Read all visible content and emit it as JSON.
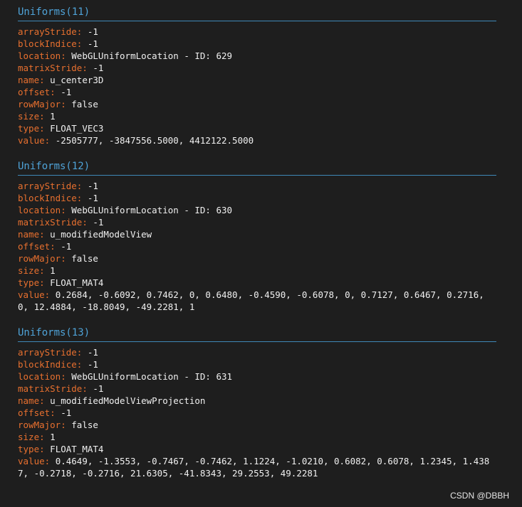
{
  "sections": [
    {
      "title": "Uniforms(11)",
      "rows": [
        {
          "key": "arrayStride",
          "value": "-1"
        },
        {
          "key": "blockIndice",
          "value": "-1"
        },
        {
          "key": "location",
          "value": "WebGLUniformLocation - ID: 629"
        },
        {
          "key": "matrixStride",
          "value": "-1"
        },
        {
          "key": "name",
          "value": "u_center3D"
        },
        {
          "key": "offset",
          "value": "-1"
        },
        {
          "key": "rowMajor",
          "value": "false"
        },
        {
          "key": "size",
          "value": "1"
        },
        {
          "key": "type",
          "value": "FLOAT_VEC3"
        },
        {
          "key": "value",
          "value": "-2505777, -3847556.5000, 4412122.5000"
        }
      ]
    },
    {
      "title": "Uniforms(12)",
      "rows": [
        {
          "key": "arrayStride",
          "value": "-1"
        },
        {
          "key": "blockIndice",
          "value": "-1"
        },
        {
          "key": "location",
          "value": "WebGLUniformLocation - ID: 630"
        },
        {
          "key": "matrixStride",
          "value": "-1"
        },
        {
          "key": "name",
          "value": "u_modifiedModelView"
        },
        {
          "key": "offset",
          "value": "-1"
        },
        {
          "key": "rowMajor",
          "value": "false"
        },
        {
          "key": "size",
          "value": "1"
        },
        {
          "key": "type",
          "value": "FLOAT_MAT4"
        },
        {
          "key": "value",
          "value": "0.2684, -0.6092, 0.7462, 0, 0.6480, -0.4590, -0.6078, 0, 0.7127, 0.6467, 0.2716, 0, 12.4884, -18.8049, -49.2281, 1"
        }
      ]
    },
    {
      "title": "Uniforms(13)",
      "rows": [
        {
          "key": "arrayStride",
          "value": "-1"
        },
        {
          "key": "blockIndice",
          "value": "-1"
        },
        {
          "key": "location",
          "value": "WebGLUniformLocation - ID: 631"
        },
        {
          "key": "matrixStride",
          "value": "-1"
        },
        {
          "key": "name",
          "value": "u_modifiedModelViewProjection"
        },
        {
          "key": "offset",
          "value": "-1"
        },
        {
          "key": "rowMajor",
          "value": "false"
        },
        {
          "key": "size",
          "value": "1"
        },
        {
          "key": "type",
          "value": "FLOAT_MAT4"
        },
        {
          "key": "value",
          "value": "0.4649, -1.3553, -0.7467, -0.7462, 1.1224, -1.0210, 0.6082, 0.6078, 1.2345, 1.4387, -0.2718, -0.2716, 21.6305, -41.8343, 29.2553, 49.2281"
        }
      ]
    }
  ],
  "watermark": "CSDN @DBBH",
  "colors": {
    "background": "#1e1e1e",
    "key": "#e8702f",
    "value": "#f0f0f0",
    "title": "#4fa3d8",
    "title_underline": "#3f88b8"
  }
}
